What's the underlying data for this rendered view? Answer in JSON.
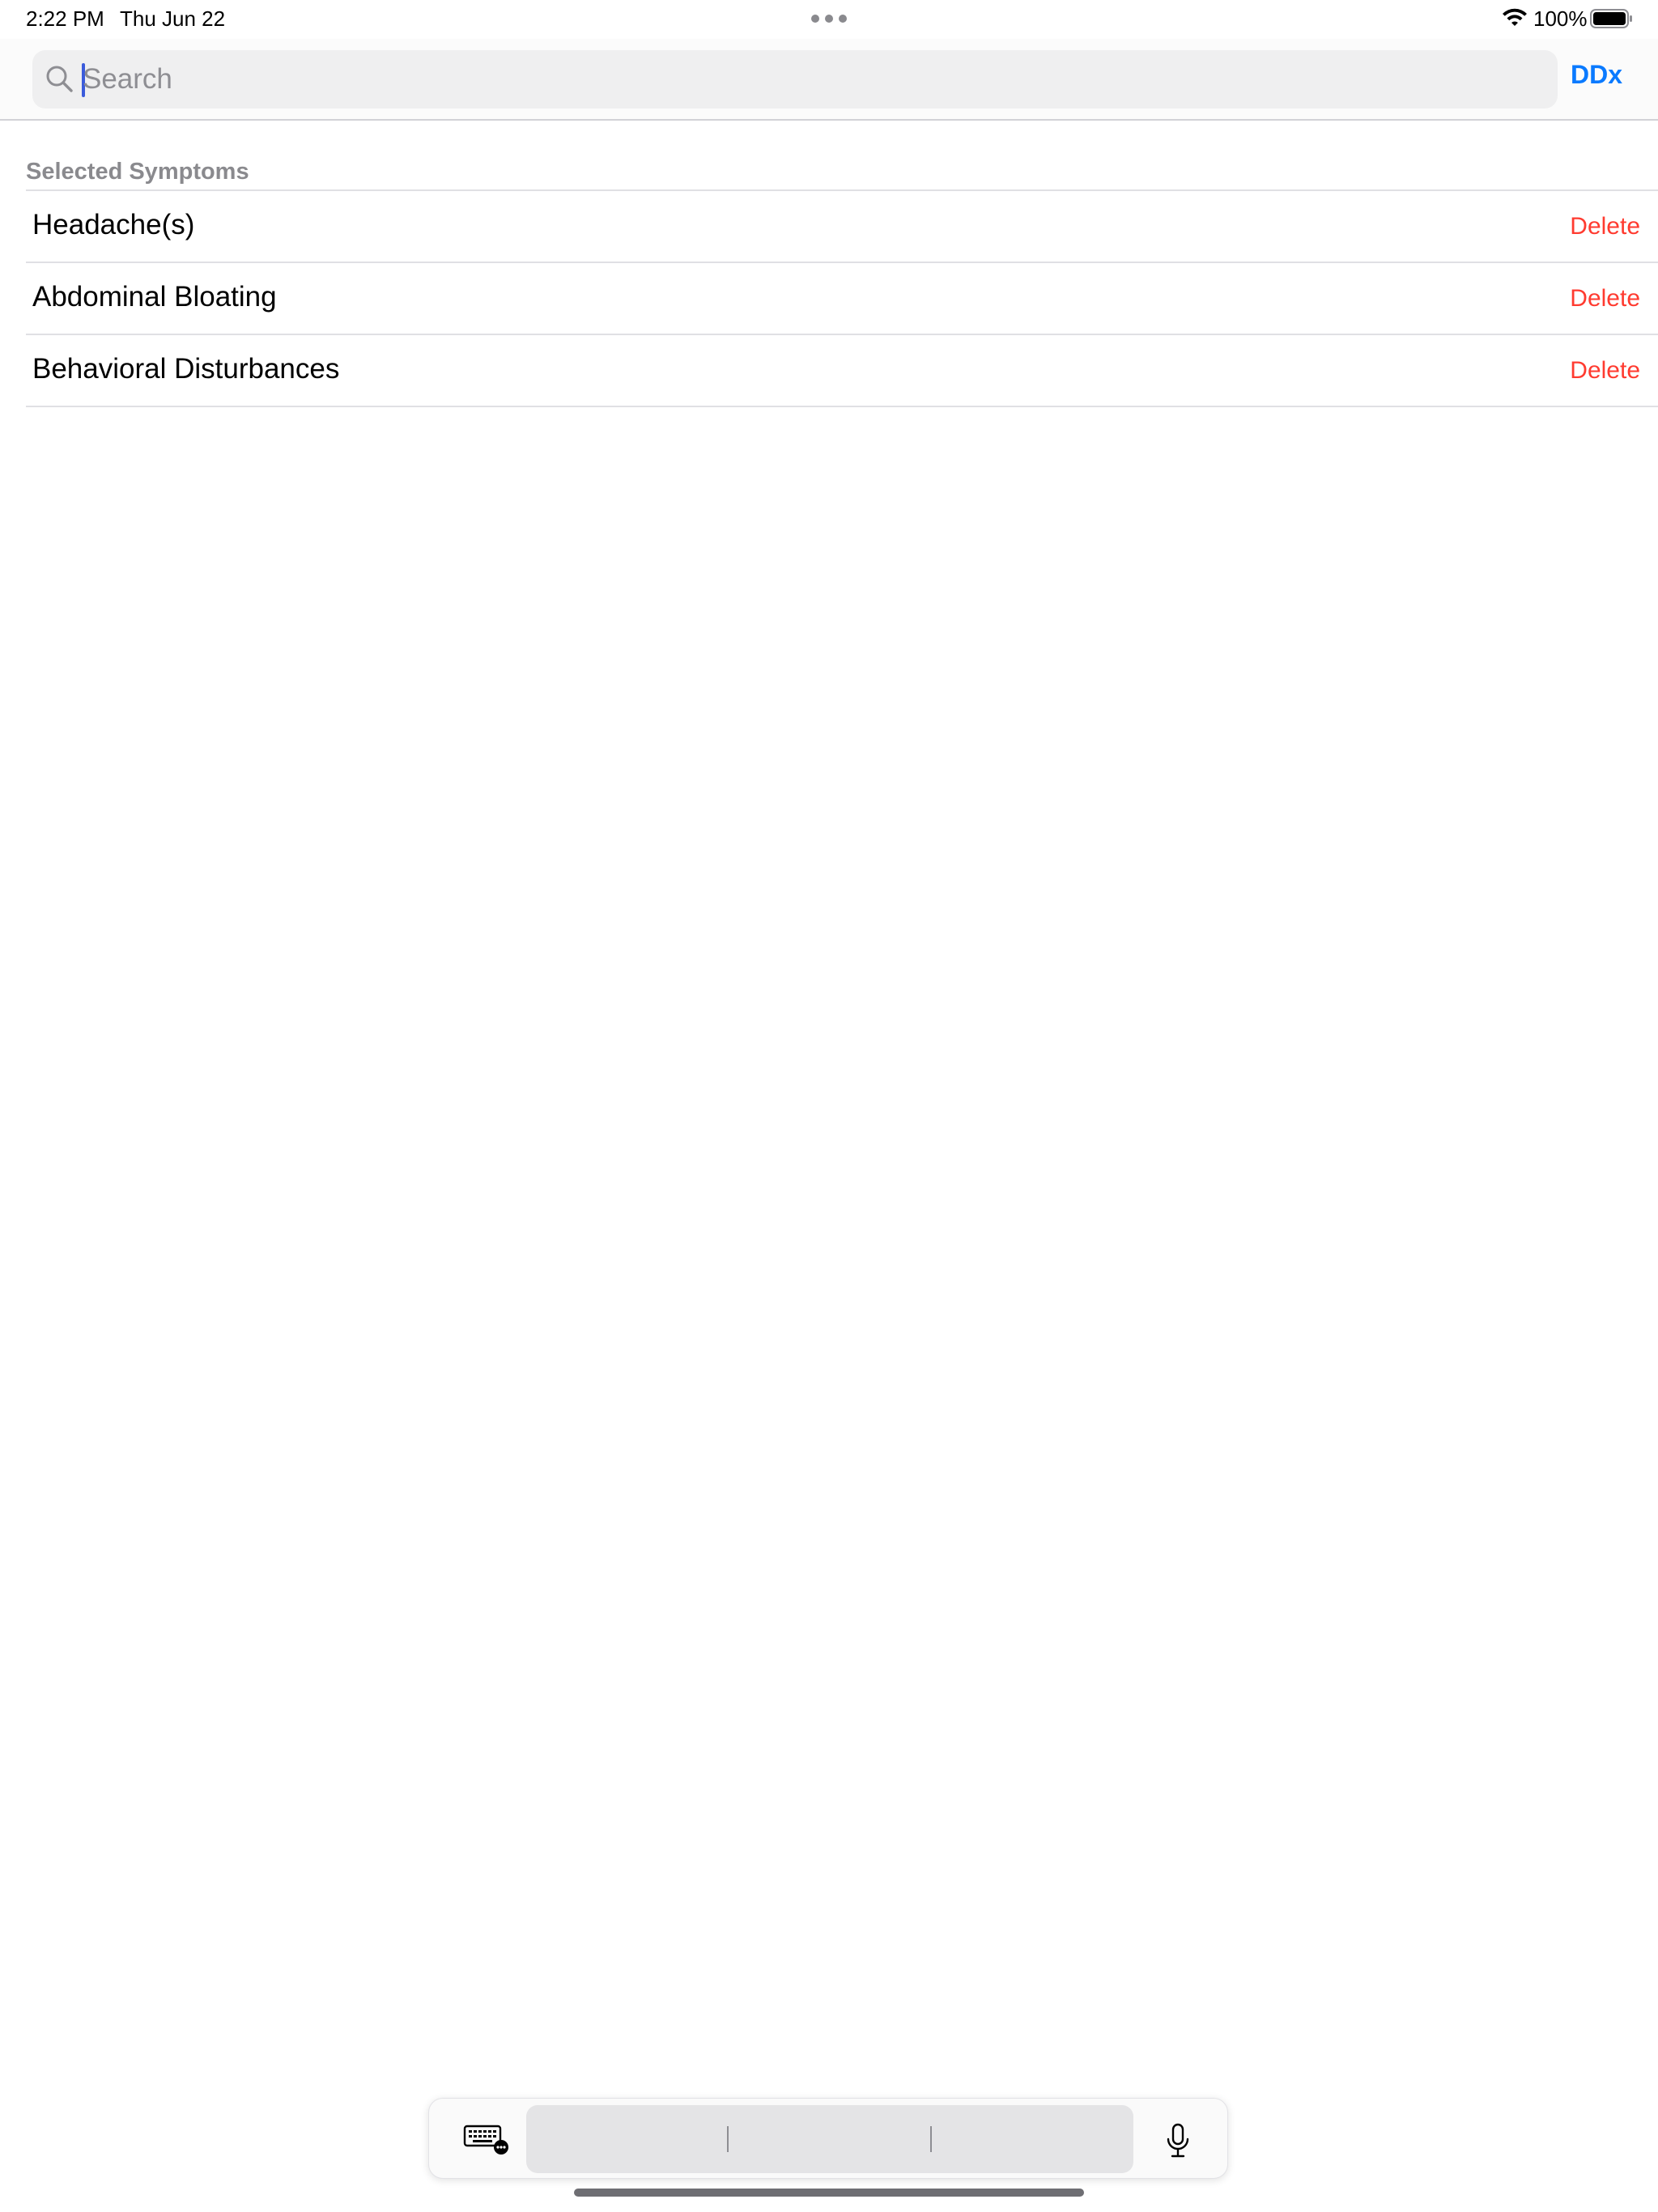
{
  "status_bar": {
    "time": "2:22 PM",
    "date": "Thu Jun 22",
    "battery_percent": "100%"
  },
  "search": {
    "placeholder": "Search",
    "value": ""
  },
  "nav": {
    "ddx_label": "DDx"
  },
  "section": {
    "header": "Selected Symptoms"
  },
  "symptoms": [
    {
      "label": "Headache(s)",
      "action": "Delete"
    },
    {
      "label": "Abdominal Bloating",
      "action": "Delete"
    },
    {
      "label": "Behavioral Disturbances",
      "action": "Delete"
    }
  ],
  "colors": {
    "accent": "#0a7aff",
    "destructive": "#ff3b30",
    "secondary_text": "#8a8a8e",
    "separator": "#e0e0e4"
  },
  "icons": {
    "status": [
      "wifi-icon",
      "battery-icon"
    ],
    "search": "search-icon",
    "keyboard_bar": [
      "keyboard-icon",
      "microphone-icon"
    ]
  }
}
